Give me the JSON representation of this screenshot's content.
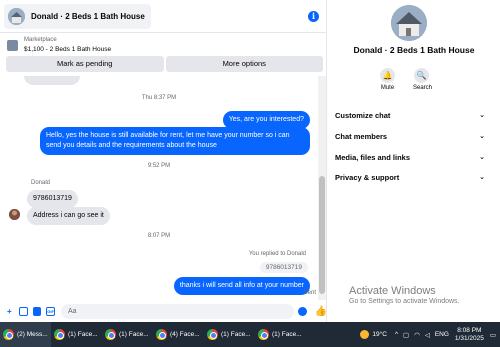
{
  "header": {
    "title": "Donald · 2 Beds 1 Bath House",
    "info_icon": "info-icon"
  },
  "listing": {
    "source": "Marketplace",
    "title": "$1,100 - 2 Beds 1 Bath House"
  },
  "actions": {
    "mark_pending": "Mark as pending",
    "more_options": "More options"
  },
  "messages": {
    "ts1": "Thu 8:37 PM",
    "out1": "Yes, are you interested?",
    "out2": "Hello, yes the house is still available for rent, let me have your number so i can send you details and the requirements about the house",
    "ts2": "9:52 PM",
    "sender": "Donald",
    "in1": "9786013719",
    "in2": "Address i can go see it",
    "ts3": "8:07 PM",
    "replied": "You replied to Donald",
    "quoted": "9786013719",
    "out3": "thanks i will send all info at your number",
    "status": "Sent"
  },
  "composer": {
    "placeholder": "Aa"
  },
  "sidebar": {
    "name": "Donald · 2 Beds 1 Bath House",
    "mute": "Mute",
    "search": "Search",
    "sections": [
      "Customize chat",
      "Chat members",
      "Media, files and links",
      "Privacy & support"
    ]
  },
  "watermark": {
    "line1": "Activate Windows",
    "line2": "Go to Settings to activate Windows."
  },
  "taskbar": {
    "items": [
      "(2) Mess...",
      "(1) Face...",
      "(1) Face...",
      "(4) Face...",
      "(1) Face...",
      "(1) Face..."
    ],
    "temp": "19°C",
    "lang": "ENG",
    "time": "8:08 PM",
    "date": "1/31/2025"
  },
  "colors": {
    "accent": "#0866ff",
    "taskbar": "#1f2a36"
  }
}
